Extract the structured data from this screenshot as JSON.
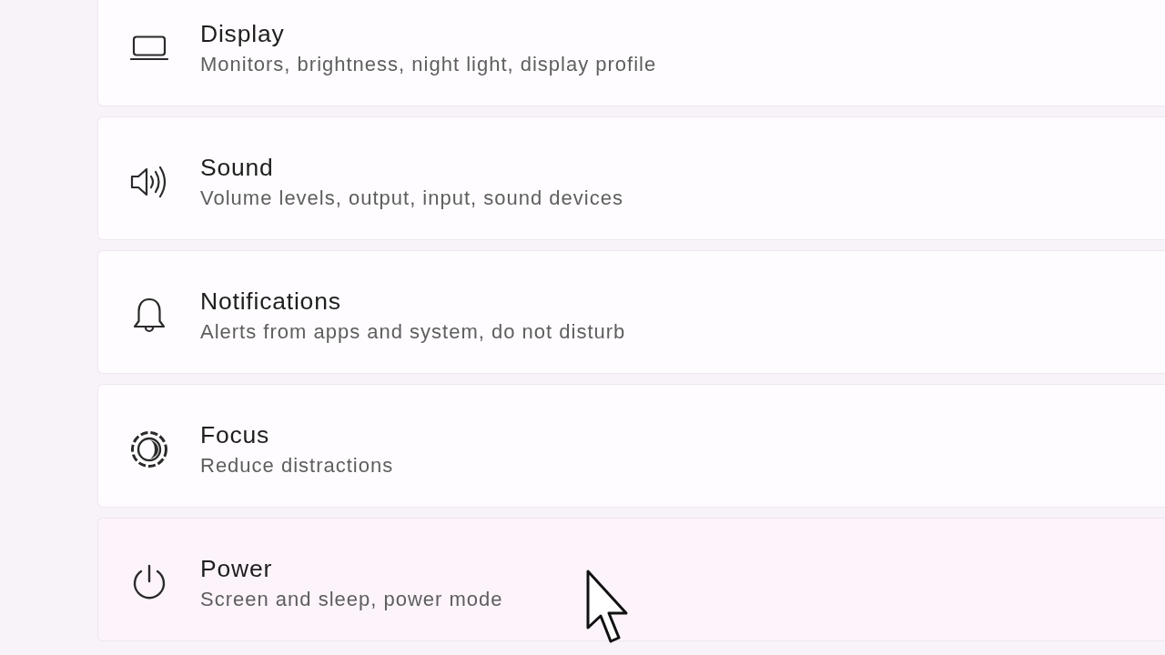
{
  "items": [
    {
      "title": "Display",
      "description": "Monitors, brightness, night light, display profile",
      "hovered": false
    },
    {
      "title": "Sound",
      "description": "Volume levels, output, input, sound devices",
      "hovered": false
    },
    {
      "title": "Notifications",
      "description": "Alerts from apps and system, do not disturb",
      "hovered": false
    },
    {
      "title": "Focus",
      "description": "Reduce distractions",
      "hovered": false
    },
    {
      "title": "Power",
      "description": "Screen and sleep, power mode",
      "hovered": true
    }
  ]
}
